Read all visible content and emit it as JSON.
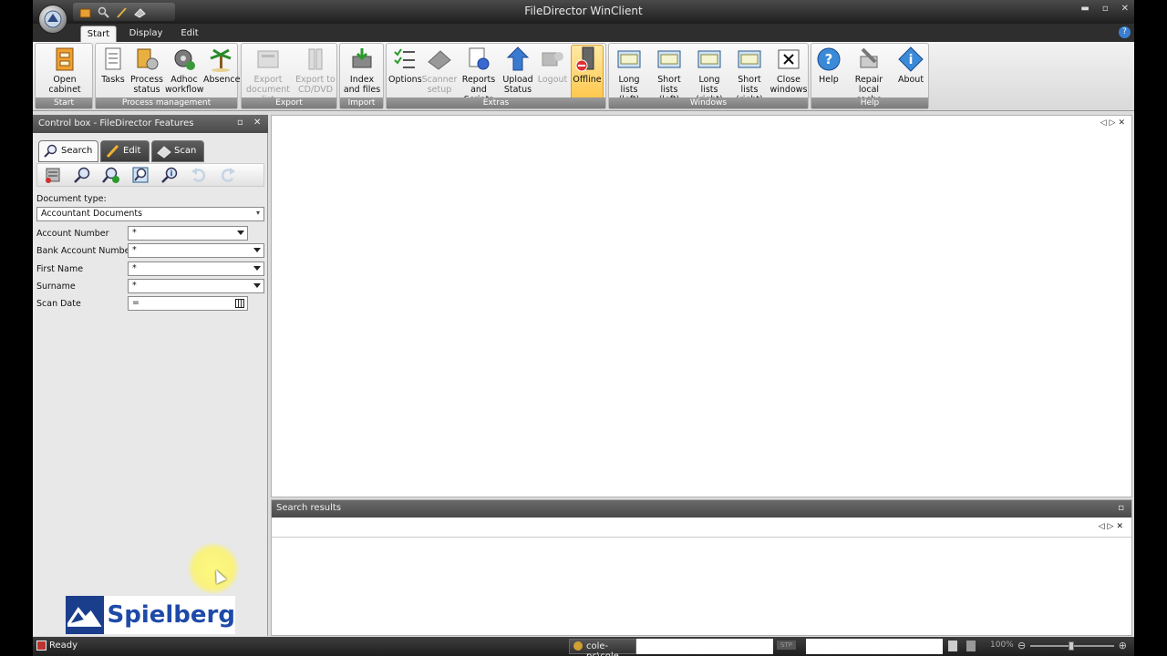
{
  "app": {
    "title": "FileDirector WinClient"
  },
  "menu_tabs": [
    {
      "label": "Start",
      "active": true
    },
    {
      "label": "Display",
      "active": false
    },
    {
      "label": "Edit",
      "active": false
    }
  ],
  "ribbon": {
    "groups": [
      {
        "label": "Start",
        "buttons": [
          {
            "label": "Open cabinet",
            "icon": "cabinet-icon"
          }
        ]
      },
      {
        "label": "Process management",
        "buttons": [
          {
            "label": "Tasks",
            "icon": "tasks-icon"
          },
          {
            "label": "Process status",
            "icon": "process-status-icon"
          },
          {
            "label": "Adhoc workflow",
            "icon": "workflow-icon"
          },
          {
            "label": "Absence",
            "icon": "palm-tree-icon"
          }
        ]
      },
      {
        "label": "Export",
        "buttons": [
          {
            "label": "Export document list",
            "icon": "export-list-icon",
            "disabled": true
          },
          {
            "label": "Export to CD/DVD",
            "icon": "export-cd-icon",
            "disabled": true
          }
        ]
      },
      {
        "label": "Import",
        "buttons": [
          {
            "label": "Index and files",
            "icon": "index-files-icon"
          }
        ]
      },
      {
        "label": "Extras",
        "buttons": [
          {
            "label": "Options",
            "icon": "options-icon"
          },
          {
            "label": "Scanner setup",
            "icon": "scanner-icon",
            "disabled": true
          },
          {
            "label": "Reports and Scripts",
            "icon": "reports-icon"
          },
          {
            "label": "Upload Status",
            "icon": "upload-icon"
          },
          {
            "label": "Logout",
            "icon": "logout-icon",
            "disabled": true
          },
          {
            "label": "Offline",
            "icon": "offline-icon",
            "highlight": true
          }
        ]
      },
      {
        "label": "Windows",
        "buttons": [
          {
            "label": "Long lists (left)",
            "icon": "list-icon"
          },
          {
            "label": "Short lists (left)",
            "icon": "list-icon"
          },
          {
            "label": "Long lists (right)",
            "icon": "list-icon"
          },
          {
            "label": "Short lists (right)",
            "icon": "list-icon"
          },
          {
            "label": "Close windows",
            "icon": "close-windows-icon"
          }
        ]
      },
      {
        "label": "Help",
        "buttons": [
          {
            "label": "Help",
            "icon": "help-icon"
          },
          {
            "label": "Repair local cache",
            "icon": "repair-icon"
          },
          {
            "label": "About",
            "icon": "about-icon"
          }
        ]
      }
    ]
  },
  "control_box": {
    "title": "Control box - FileDirector Features",
    "tabs": [
      {
        "label": "Search",
        "active": true
      },
      {
        "label": "Edit",
        "active": false
      },
      {
        "label": "Scan",
        "active": false
      }
    ],
    "document_type_label": "Document type:",
    "document_type_value": "Accountant Documents",
    "fields": [
      {
        "label": "Account Number",
        "value": "*"
      },
      {
        "label": "Bank Account Number",
        "value": "*"
      },
      {
        "label": "First Name",
        "value": "*"
      },
      {
        "label": "Surname",
        "value": "*"
      },
      {
        "label": "Scan Date",
        "value": "="
      }
    ],
    "logo_text": "Spielberg"
  },
  "search_results": {
    "title": "Search results"
  },
  "status": {
    "ready": "Ready",
    "user": "cole-pc\\cole",
    "stop": "STP",
    "zoom": "100%"
  },
  "colors": {
    "accent": "#3a7fd0",
    "offline_highlight": "#ffc74a",
    "logo_blue": "#1e4aa8"
  }
}
